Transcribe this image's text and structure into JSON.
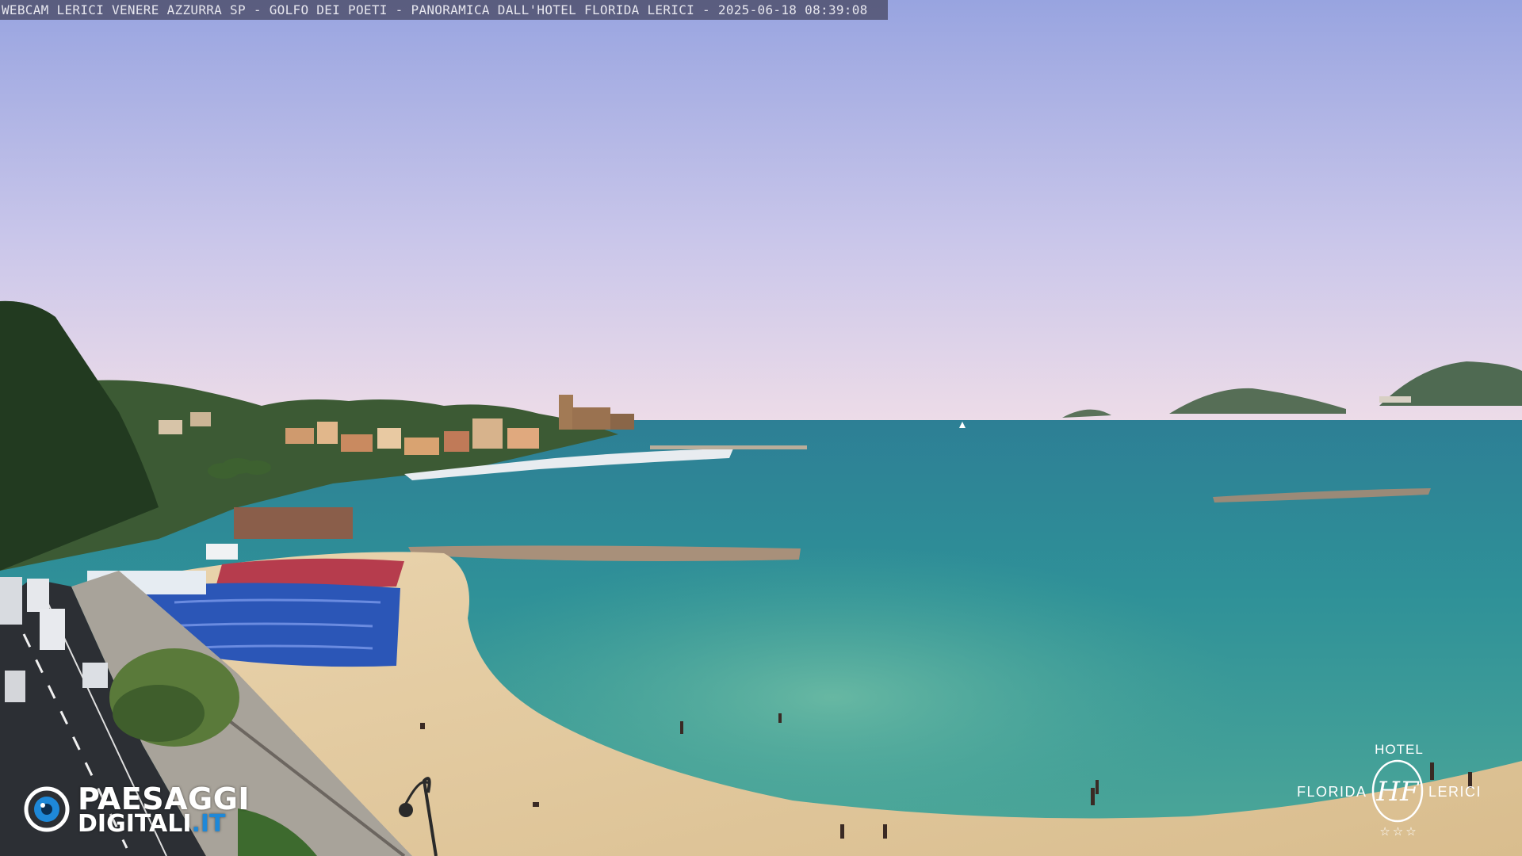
{
  "caption": {
    "text": "WEBCAM LERICI VENERE AZZURRA SP - GOLFO DEI POETI - PANORAMICA DALL'HOTEL FLORIDA LERICI - 2025-06-18 08:39:08"
  },
  "logo_left": {
    "line1": "PAESAGGI",
    "line2_main": "DIGITALI",
    "line2_tld": ".IT",
    "icon": "eye-icon",
    "accent": "#1e88d8"
  },
  "logo_right": {
    "top_word": "HOTEL",
    "left_word": "FLORIDA",
    "right_word": "LERICI",
    "monogram": "HF",
    "stars": "☆☆☆"
  },
  "scene": {
    "sky_top": "#9aa6e2",
    "sky_bottom": "#ecd9e6",
    "sea_far": "#2c8a9a",
    "sea_near": "#4aa69a",
    "sand": "#e6cfa8",
    "vegetation": "#2e4a2a",
    "umbrella_blue": "#2a55b8",
    "umbrella_red": "#b83a4a"
  }
}
